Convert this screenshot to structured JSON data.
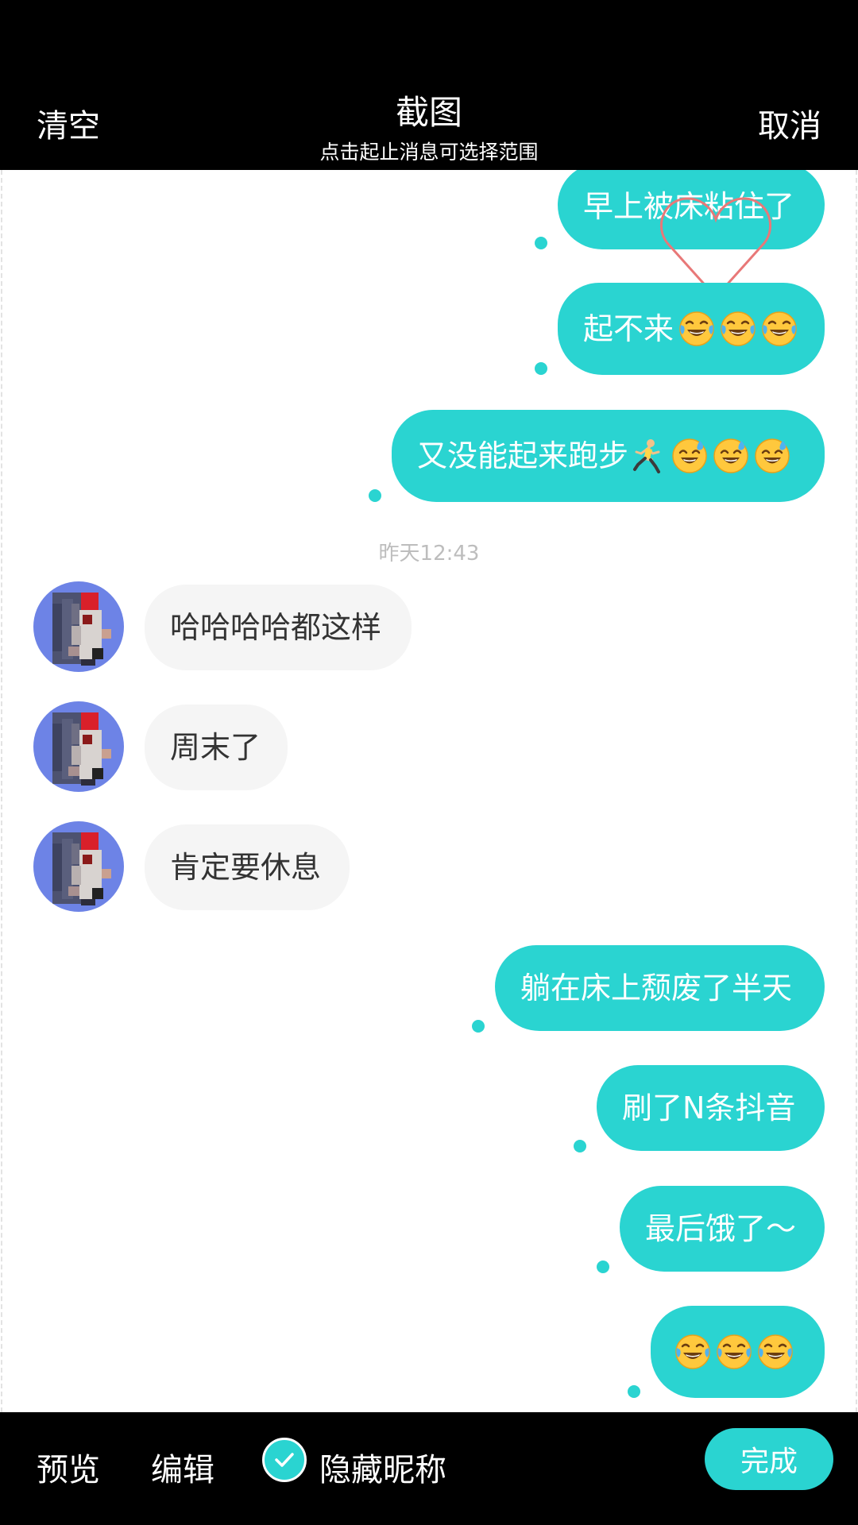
{
  "header": {
    "clear_label": "清空",
    "title": "截图",
    "subtitle": "点击起止消息可选择范围",
    "cancel_label": "取消"
  },
  "messages": [
    {
      "side": "out",
      "text": "早上被床粘住了",
      "emoji": []
    },
    {
      "side": "out",
      "text": "起不来",
      "emoji": [
        "laugh-cry-emoji",
        "laugh-cry-emoji",
        "laugh-cry-emoji"
      ]
    },
    {
      "side": "out",
      "text": "又没能起来跑步",
      "emoji": [
        "runner-emoji",
        "sweat-smile-emoji",
        "sweat-smile-emoji",
        "sweat-smile-emoji"
      ]
    },
    {
      "side": "in",
      "text": "哈哈哈哈都这样",
      "emoji": []
    },
    {
      "side": "in",
      "text": "周末了",
      "emoji": []
    },
    {
      "side": "in",
      "text": "肯定要休息",
      "emoji": []
    },
    {
      "side": "out",
      "text": "躺在床上颓废了半天",
      "emoji": []
    },
    {
      "side": "out",
      "text": "刷了N条抖音",
      "emoji": []
    },
    {
      "side": "out",
      "text": "最后饿了～",
      "emoji": []
    },
    {
      "side": "out",
      "text": "",
      "emoji": [
        "laugh-cry-emoji",
        "laugh-cry-emoji",
        "laugh-cry-emoji"
      ]
    }
  ],
  "timestamp": "昨天12:43",
  "footer": {
    "preview_label": "预览",
    "edit_label": "编辑",
    "hide_nickname_label": "隐藏昵称",
    "hide_nickname_checked": true,
    "done_label": "完成"
  },
  "colors": {
    "accent": "#2ad4d1",
    "incoming_bubble": "#f5f5f5",
    "bar_background": "#000000",
    "heart_outline": "#e87878",
    "timestamp_text": "#bdbdbd"
  },
  "icons": {
    "check": "check-icon",
    "avatar": "pixelated-avatar",
    "heart": "heart-outline-icon"
  }
}
